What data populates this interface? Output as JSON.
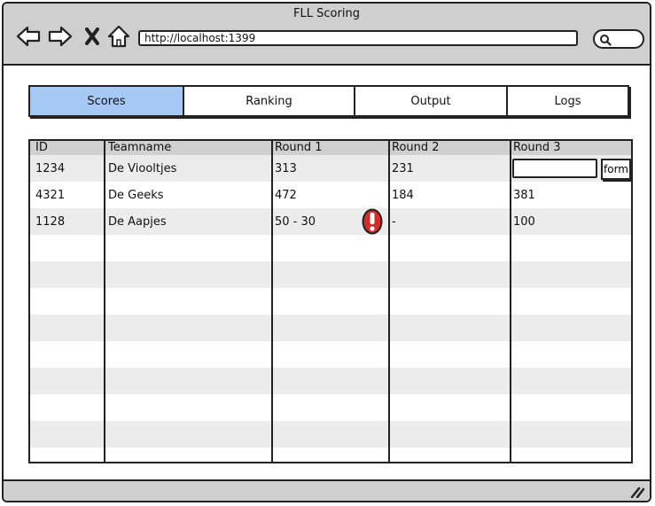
{
  "window": {
    "title": "FLL Scoring"
  },
  "address_bar": {
    "url": "http://localhost:1399"
  },
  "icons": {
    "back": "arrow-left-icon",
    "forward": "arrow-right-icon",
    "stop": "close-x-icon",
    "home": "home-icon",
    "search": "search-icon",
    "warning": "warning-icon",
    "resize": "resize-grip-icon"
  },
  "tabs": [
    {
      "label": "Scores",
      "active": true
    },
    {
      "label": "Ranking",
      "active": false
    },
    {
      "label": "Output",
      "active": false
    },
    {
      "label": "Logs",
      "active": false
    }
  ],
  "table": {
    "headers": [
      "ID",
      "Teamname",
      "Round 1",
      "Round 2",
      "Round 3"
    ],
    "rows": [
      [
        "1234",
        "De Viooltjes",
        "313",
        "231",
        ""
      ],
      [
        "4321",
        "De Geeks",
        "472",
        "184",
        "381"
      ],
      [
        "1128",
        "De Aapjes",
        "50 - 30",
        "-",
        "100"
      ]
    ],
    "round3_input_value": "",
    "round3_button_label": "form"
  },
  "colors": {
    "active_tab": "#a6c8f5",
    "chrome": "#cfcfcf",
    "header_row": "#d0d0d0",
    "alt_row": "#ececec",
    "warning": "#d42a2a"
  }
}
